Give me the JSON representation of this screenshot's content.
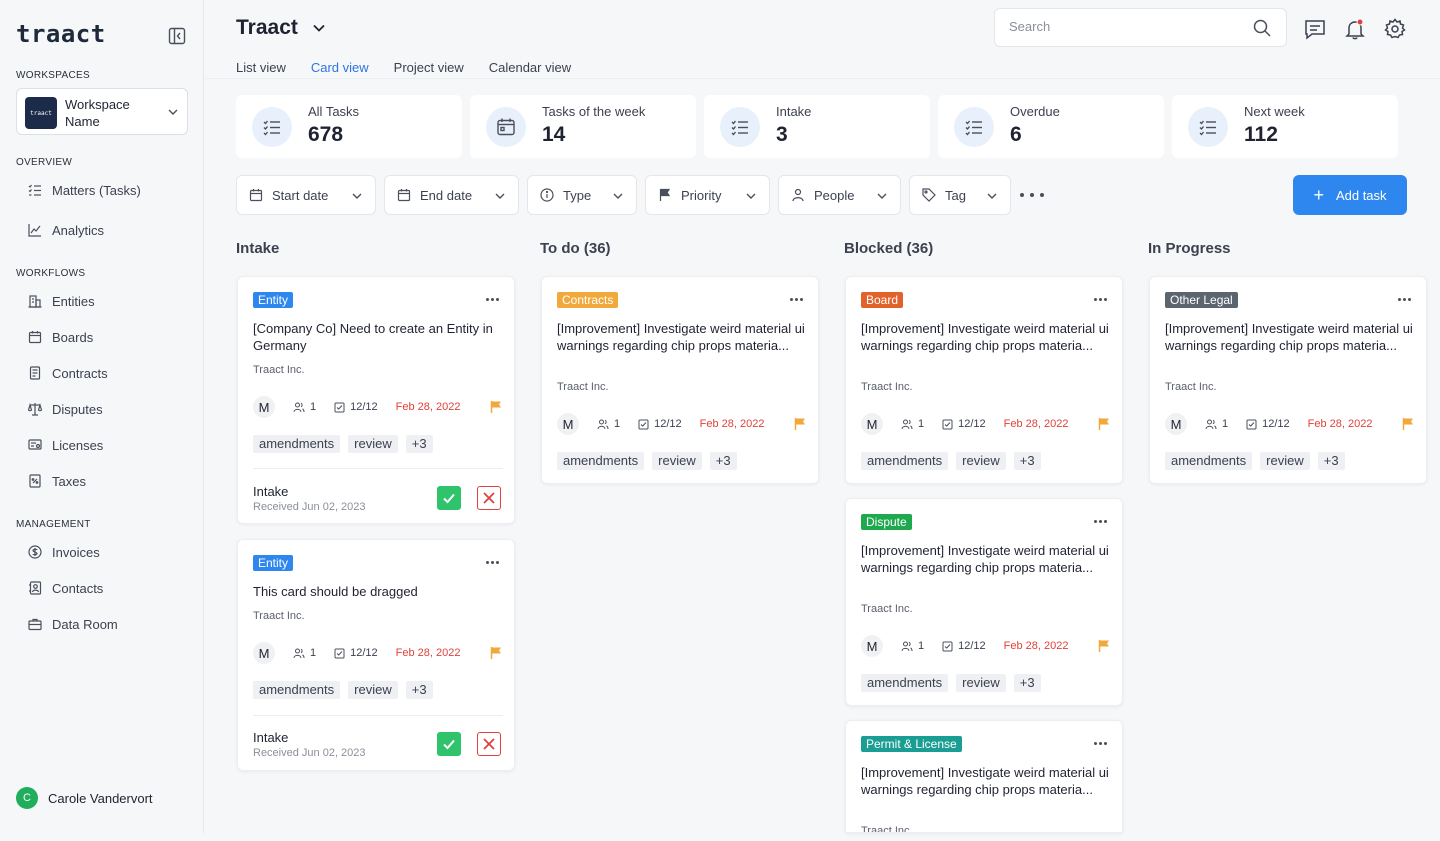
{
  "sidebar": {
    "logo": "traact",
    "workspaces_label": "WORKSPACES",
    "workspace": {
      "logo_text": "traact",
      "name": "Workspace Name"
    },
    "overview_label": "OVERVIEW",
    "overview": [
      {
        "label": "Matters (Tasks)",
        "icon": "list-check-icon"
      },
      {
        "label": "Analytics",
        "icon": "chart-icon"
      }
    ],
    "workflows_label": "WORKFLOWS",
    "workflows": [
      {
        "label": "Entities",
        "icon": "building-icon"
      },
      {
        "label": "Boards",
        "icon": "calendar-icon"
      },
      {
        "label": "Contracts",
        "icon": "document-icon"
      },
      {
        "label": "Disputes",
        "icon": "scale-icon"
      },
      {
        "label": "Licenses",
        "icon": "license-icon"
      },
      {
        "label": "Taxes",
        "icon": "tax-icon"
      }
    ],
    "management_label": "MANAGEMENT",
    "management": [
      {
        "label": "Invoices",
        "icon": "dollar-icon"
      },
      {
        "label": "Contacts",
        "icon": "contacts-icon"
      },
      {
        "label": "Data Room",
        "icon": "briefcase-icon"
      }
    ],
    "user": {
      "initial": "C",
      "name": "Carole Vandervort"
    }
  },
  "header": {
    "title": "Traact",
    "tabs": [
      "List view",
      "Card view",
      "Project view",
      "Calendar view"
    ],
    "active_tab": "Card view",
    "search_placeholder": "Search"
  },
  "stats": [
    {
      "label": "All Tasks",
      "value": "678"
    },
    {
      "label": "Tasks of the week",
      "value": "14"
    },
    {
      "label": "Intake",
      "value": "3"
    },
    {
      "label": "Overdue",
      "value": "6"
    },
    {
      "label": "Next week",
      "value": "112"
    }
  ],
  "filters": [
    "Start date",
    "End date",
    "Type",
    "Priority",
    "People",
    "Tag"
  ],
  "add_task_label": "Add task",
  "columns": [
    {
      "title": "Intake"
    },
    {
      "title": "To do (36)"
    },
    {
      "title": "Blocked (36)"
    },
    {
      "title": "In Progress"
    }
  ],
  "cards": [
    {
      "badge": "Entity",
      "title": "[Company Co] Need to create an Entity in Germany",
      "company": "Traact Inc.",
      "avatar": "M",
      "people": "1",
      "checklist": "12/12",
      "due": "Feb 28, 2022",
      "tags": [
        "amendments",
        "review",
        "+3"
      ],
      "intake_label": "Intake",
      "received": "Received Jun 02, 2023"
    },
    {
      "badge": "Entity",
      "title": "This card should be dragged",
      "company": "Traact Inc.",
      "avatar": "M",
      "people": "1",
      "checklist": "12/12",
      "due": "Feb 28, 2022",
      "tags": [
        "amendments",
        "review",
        "+3"
      ],
      "intake_label": "Intake",
      "received": "Received Jun 02, 2023"
    },
    {
      "badge": "Contracts",
      "title": "[Improvement] Investigate weird material ui warnings regarding chip props materia...",
      "company": "Traact Inc.",
      "avatar": "M",
      "people": "1",
      "checklist": "12/12",
      "due": "Feb 28, 2022",
      "tags": [
        "amendments",
        "review",
        "+3"
      ]
    },
    {
      "badge": "Board",
      "title": "[Improvement] Investigate weird material ui warnings regarding chip props materia...",
      "company": "Traact Inc.",
      "avatar": "M",
      "people": "1",
      "checklist": "12/12",
      "due": "Feb 28, 2022",
      "tags": [
        "amendments",
        "review",
        "+3"
      ]
    },
    {
      "badge": "Dispute",
      "title": "[Improvement] Investigate weird material ui warnings regarding chip props materia...",
      "company": "Traact Inc.",
      "avatar": "M",
      "people": "1",
      "checklist": "12/12",
      "due": "Feb 28, 2022",
      "tags": [
        "amendments",
        "review",
        "+3"
      ]
    },
    {
      "badge": "Permit & License",
      "title": "[Improvement] Investigate weird material ui warnings regarding chip props materia...",
      "company": "Traact Inc."
    },
    {
      "badge": "Other Legal",
      "title": "[Improvement] Investigate weird material ui warnings regarding chip props materia...",
      "company": "Traact Inc.",
      "avatar": "M",
      "people": "1",
      "checklist": "12/12",
      "due": "Feb 28, 2022",
      "tags": [
        "amendments",
        "review",
        "+3"
      ]
    }
  ],
  "colors": {
    "accent": "#2d87ef",
    "entity": "#2d87ef",
    "contracts": "#f2a93b",
    "board": "#e2622b",
    "dispute": "#1fa94f",
    "permit": "#1a9e94",
    "other_legal": "#5c6470",
    "due": "#e0413a",
    "flag": "#f2a93b"
  }
}
